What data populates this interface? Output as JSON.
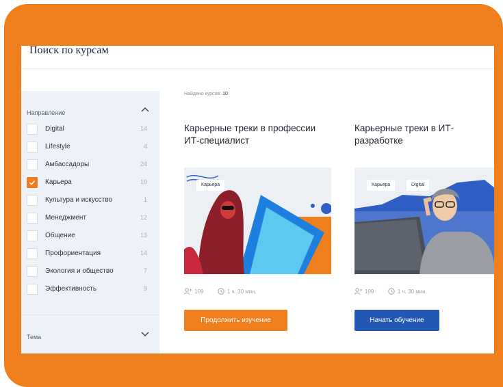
{
  "page": {
    "title": "Поиск по курсам"
  },
  "filters": {
    "direction": {
      "title": "Направление",
      "items": [
        {
          "label": "Digital",
          "count": "14",
          "checked": false
        },
        {
          "label": "Lifestyle",
          "count": "4",
          "checked": false
        },
        {
          "label": "Амбассадоры",
          "count": "24",
          "checked": false
        },
        {
          "label": "Карьера",
          "count": "10",
          "checked": true
        },
        {
          "label": "Культура и искусство",
          "count": "1",
          "checked": false
        },
        {
          "label": "Менеджмент",
          "count": "12",
          "checked": false
        },
        {
          "label": "Общение",
          "count": "13",
          "checked": false
        },
        {
          "label": "Профориентация",
          "count": "14",
          "checked": false
        },
        {
          "label": "Экология и общество",
          "count": "7",
          "checked": false
        },
        {
          "label": "Эффективность",
          "count": "9",
          "checked": false
        }
      ]
    },
    "theme": {
      "title": "Тема"
    }
  },
  "results": {
    "found_label": "Найдено курсов:",
    "found_count": "10"
  },
  "courses": [
    {
      "title": "Карьерные треки в профессии ИТ-специалист",
      "tags": [
        "Карьера"
      ],
      "participants": "109",
      "duration": "1 ч. 30 мин.",
      "button": "Продолжить изучение"
    },
    {
      "title": "Карьерные треки в ИТ-разработке",
      "tags": [
        "Карьера",
        "Digital"
      ],
      "participants": "109",
      "duration": "1 ч. 30 мин.",
      "button": "Начать обучение"
    }
  ],
  "colors": {
    "frame": "#ee7f1c",
    "accent_orange": "#ee7f1c",
    "accent_blue": "#2458b5",
    "sidebar_bg": "#edf2f8"
  },
  "icons": {
    "collapse": "chevron-up-icon",
    "expand": "chevron-down-icon",
    "check": "check-icon",
    "participants": "user-plus-icon",
    "duration": "clock-icon"
  }
}
